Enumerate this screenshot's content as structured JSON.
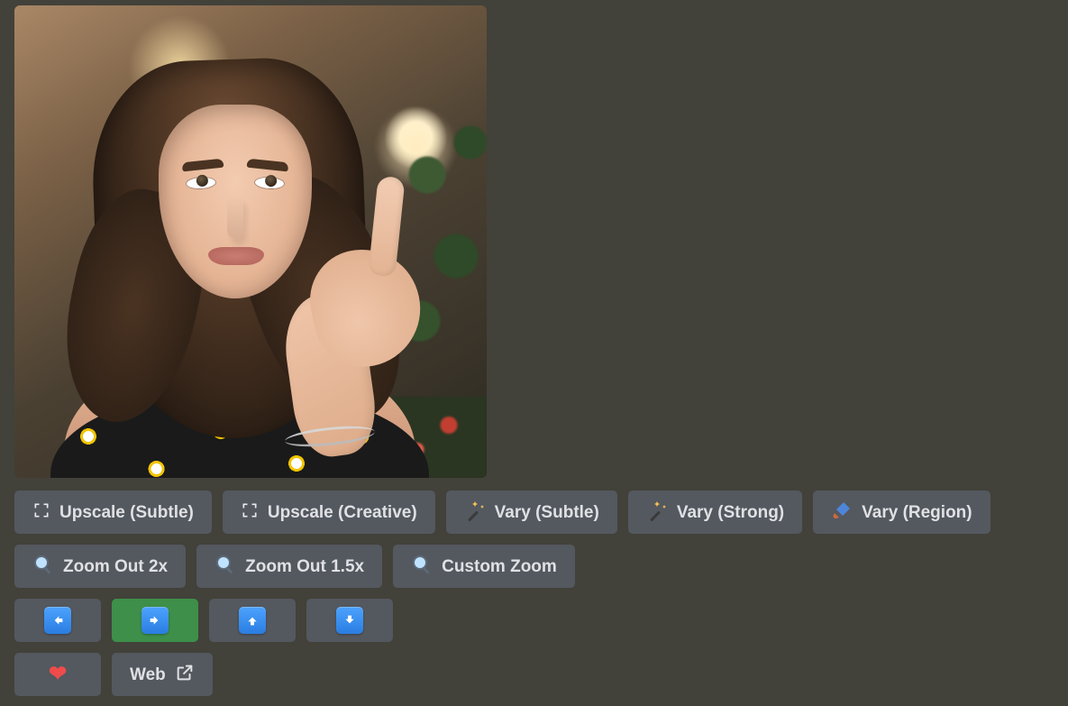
{
  "image": {
    "alt": "Generated image: young woman with wavy brown hair looking up and pointing upward, warm bokeh street background"
  },
  "buttons": {
    "row1": {
      "upscale_subtle": {
        "label": "Upscale (Subtle)"
      },
      "upscale_creative": {
        "label": "Upscale (Creative)"
      },
      "vary_subtle": {
        "label": "Vary (Subtle)"
      },
      "vary_strong": {
        "label": "Vary (Strong)"
      },
      "vary_region": {
        "label": "Vary (Region)"
      }
    },
    "row2": {
      "zoom_out_2x": {
        "label": "Zoom Out 2x"
      },
      "zoom_out_15x": {
        "label": "Zoom Out 1.5x"
      },
      "custom_zoom": {
        "label": "Custom Zoom"
      }
    },
    "row3": {
      "pan_left": {
        "label": ""
      },
      "pan_right": {
        "label": ""
      },
      "pan_up": {
        "label": ""
      },
      "pan_down": {
        "label": ""
      }
    },
    "row4": {
      "favorite": {
        "label": ""
      },
      "web": {
        "label": "Web"
      }
    }
  }
}
